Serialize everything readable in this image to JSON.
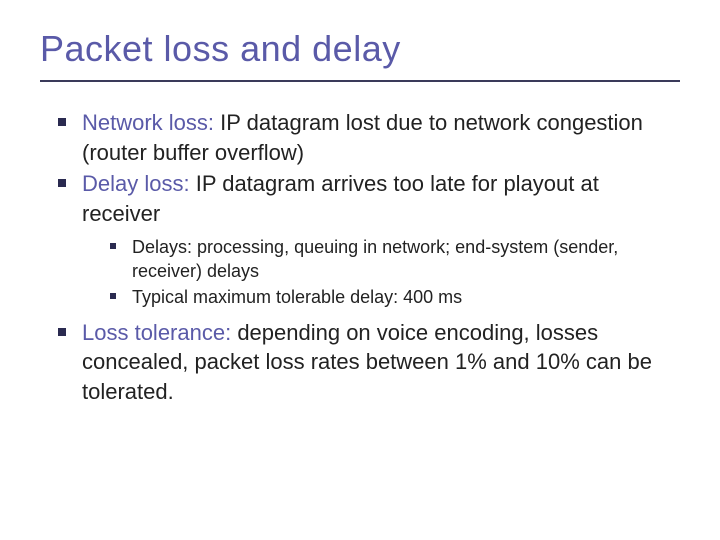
{
  "title": "Packet loss and delay",
  "bullets": {
    "b1": {
      "lead": "Network loss:",
      "rest": " IP datagram lost due to network congestion (router buffer overflow)"
    },
    "b2": {
      "lead": "Delay loss:",
      "rest": " IP datagram arrives too late for playout at receiver"
    },
    "b2sub": {
      "s1": "Delays: processing, queuing in network; end-system (sender, receiver) delays",
      "s2": "Typical maximum tolerable delay: 400 ms"
    },
    "b3": {
      "lead": "Loss tolerance:",
      "rest": " depending on voice encoding, losses concealed, packet loss rates between 1% and 10% can be tolerated."
    }
  }
}
